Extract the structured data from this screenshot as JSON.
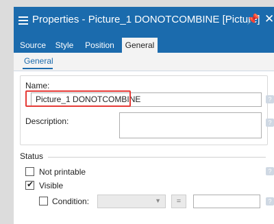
{
  "window": {
    "title": "Properties - Picture_1 DONOTCOMBINE [Picture]"
  },
  "tabs": [
    {
      "label": "Source",
      "active": false
    },
    {
      "label": "Style",
      "active": false
    },
    {
      "label": "Position",
      "active": false
    },
    {
      "label": "General",
      "active": true
    }
  ],
  "subtabs": [
    {
      "label": "General",
      "active": true
    }
  ],
  "general": {
    "name_label": "Name:",
    "name_value": "Picture_1 DONOTCOMBINE",
    "description_label": "Description:",
    "description_value": ""
  },
  "status": {
    "title": "Status",
    "not_printable_label": "Not printable",
    "not_printable_checked": false,
    "visible_label": "Visible",
    "visible_checked": true,
    "condition_label": "Condition:",
    "condition_checked": false,
    "condition_selected": "",
    "equals_label": "=",
    "condition_value": ""
  },
  "colors": {
    "accent": "#1b6bad",
    "highlight": "#e53935"
  },
  "icons": {
    "menu": "hamburger-icon",
    "pin": "pin-icon",
    "close": "close-icon",
    "help": "help-icon",
    "dropdown": "chevron-down-icon"
  }
}
